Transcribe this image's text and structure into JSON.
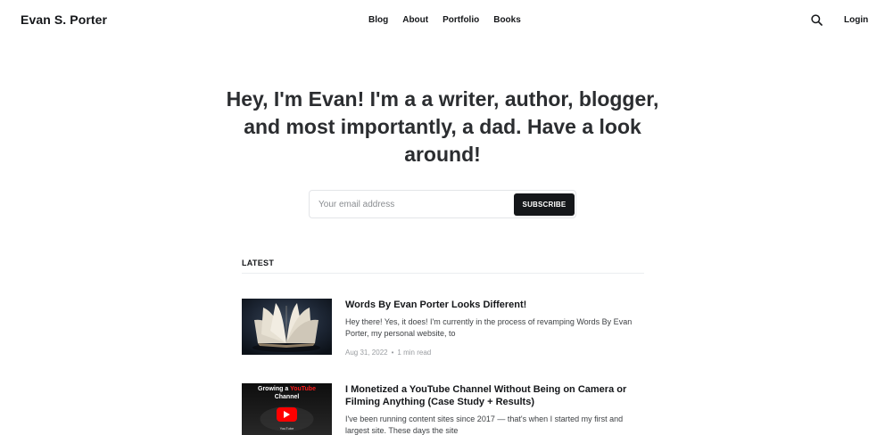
{
  "header": {
    "site_title": "Evan S. Porter",
    "nav": [
      "Blog",
      "About",
      "Portfolio",
      "Books"
    ],
    "search_icon": "search-icon",
    "login_label": "Login"
  },
  "hero": {
    "title": "Hey, I'm Evan! I'm a a writer, author, blogger, and most importantly, a dad. Have a look around!"
  },
  "subscribe": {
    "email_placeholder": "Your email address",
    "email_value": "",
    "button_label": "SUBSCRIBE"
  },
  "latest": {
    "label": "LATEST",
    "posts": [
      {
        "title": "Words By Evan Porter Looks Different!",
        "excerpt": "Hey there! Yes, it does! I'm currently in the process of revamping Words By Evan Porter, my personal website, to",
        "date": "Aug 31, 2022",
        "read_time": "1 min read",
        "image": "open-book-photo"
      },
      {
        "title": "I Monetized a YouTube Channel Without Being on Camera or Filming Anything (Case Study + Results)",
        "excerpt": "I've been running content sites since 2017 — that's when I started my first and largest site. These days the site",
        "image": "youtube-channel-thumbnail",
        "image_text_line1": "Growing a",
        "image_text_highlight": "YouTube",
        "image_text_line2": "Channel",
        "image_small_text": "YouTube"
      }
    ]
  },
  "colors": {
    "text": "#15171a",
    "button_bg": "#15171a",
    "youtube_red": "#ff0000"
  }
}
